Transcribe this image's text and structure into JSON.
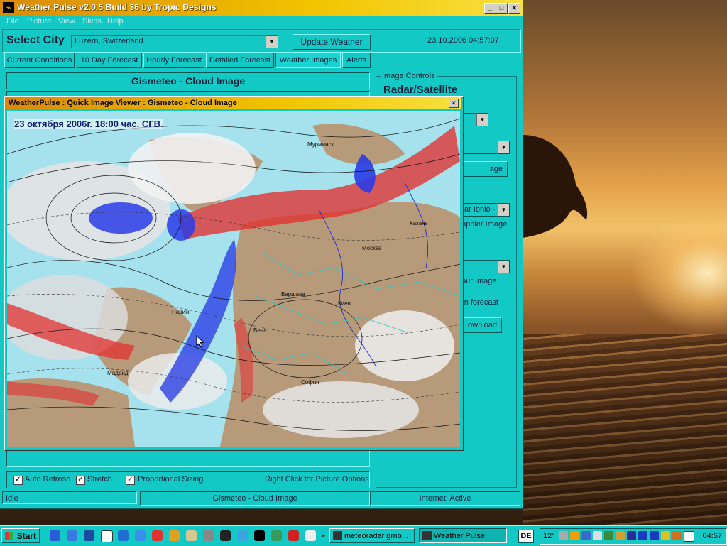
{
  "window": {
    "title": "Weather Pulse v2.0.5 Build 36 by Tropic Designs",
    "menu": [
      "File",
      "Picture",
      "View",
      "Skins",
      "Help"
    ]
  },
  "city": {
    "label": "Select City",
    "selected": "Luzern, Switzerland",
    "update_label": "Update Weather",
    "datetime": "23.10.2006 04:57:07"
  },
  "tabs": [
    "Current Conditions",
    "10 Day Forecast",
    "Hourly Forecast",
    "Detailed Forecast",
    "Weather Images",
    "Alerts"
  ],
  "active_tab": "Weather Images",
  "image_panel": {
    "title": "Gismeteo - Cloud  Image"
  },
  "controls": {
    "group_label": "Image Controls",
    "heading": "Radar/Satellite",
    "select2_value": "ar Ionio - It",
    "label_doppler": "oppler Image",
    "label_contour": "our Image",
    "btn_image": "age",
    "btn_forecast": "n forecast",
    "btn_download": "ownload"
  },
  "options": {
    "auto_refresh": "Auto Refresh",
    "stretch": "Stretch",
    "proportional": "Proportional Sizing",
    "hint": "Right Click for Picture Options"
  },
  "status": {
    "state": "Idle",
    "image": "Gismeteo - Cloud  Image",
    "internet": "Internet: Active"
  },
  "viewer": {
    "title": "WeatherPulse : Quick Image Viewer : Gismeteo - Cloud  Image",
    "map_caption": "23 октября 2006г. 18:00 час. СГВ.",
    "cities": [
      "Мурманск",
      "Казань",
      "Москва",
      "Варшава",
      "Киев",
      "Париж",
      "Вена",
      "Мадрид",
      "София"
    ]
  },
  "taskbar": {
    "start": "Start",
    "tasks": [
      "meteoradar gmb...",
      "Weather Pulse"
    ],
    "lang": "DE",
    "temp": "12°",
    "clock": "04:57"
  },
  "colors": {
    "window_bg": "#12c9c6",
    "title_gradient_start": "#d98a00",
    "title_gradient_end": "#f7e040",
    "text_dark": "#0a1f3a"
  }
}
